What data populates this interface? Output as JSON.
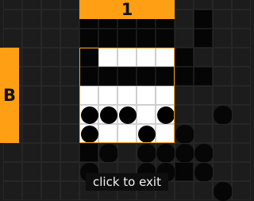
{
  "game": {
    "column_label": "1",
    "row_label": "B",
    "exit_label": "click to exit"
  },
  "board": {
    "rows": [
      "..........EE.",
      "....BBBBB.BE.",
      "....BBBBB.BE.",
      "....BWWWWBE..",
      "....BBBBBBB..",
      "....WWWWW....",
      "....XXXWX..X.",
      "....XWWXWX...",
      "....BXEXXXX..",
      "....XEEXXBX..",
      "...........X."
    ],
    "legend": {
      ".": "empty",
      "E": "empty",
      "B": "black",
      "W": "white",
      "X": "mine"
    }
  }
}
